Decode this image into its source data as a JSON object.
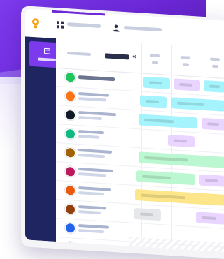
{
  "page": {
    "background_color": "#7c3aed"
  },
  "topbar": {
    "logo_icon": "bulb-icon",
    "grid_icon": "grid-icon",
    "team_icon": "people-icon"
  },
  "sidebar": {
    "active_icon": "calendar-icon"
  },
  "main": {
    "collapse_label": "«"
  },
  "rows": [
    {
      "avatar_color": "#22c55e"
    },
    {
      "avatar_color": "#f97316"
    },
    {
      "avatar_color": "#111827"
    },
    {
      "avatar_color": "#10b981"
    },
    {
      "avatar_color": "#a16207"
    },
    {
      "avatar_color": "#be185d"
    },
    {
      "avatar_color": "#ea580c"
    },
    {
      "avatar_color": "#92400e"
    },
    {
      "avatar_color": "#2563eb"
    },
    {
      "avatar_color": "#f472b6"
    }
  ],
  "events": [
    {
      "color": "cyan"
    },
    {
      "color": "purple"
    },
    {
      "color": "cyan"
    },
    {
      "color": "cyan"
    },
    {
      "color": "cyan"
    },
    {
      "color": "cyan"
    },
    {
      "color": "purple"
    },
    {
      "color": "purple"
    },
    {
      "color": "green"
    },
    {
      "color": "green"
    },
    {
      "color": "purple"
    },
    {
      "color": "amber"
    },
    {
      "color": "gray"
    },
    {
      "color": "purple"
    }
  ]
}
